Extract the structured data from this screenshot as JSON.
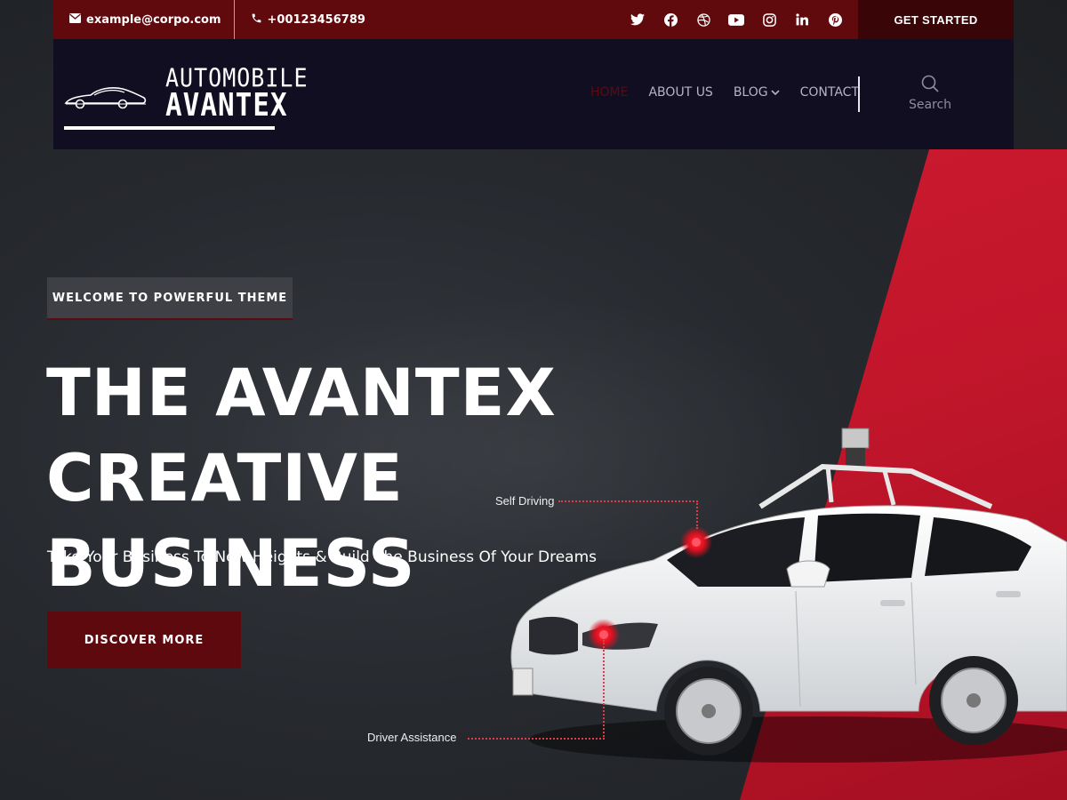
{
  "topbar": {
    "email": "example@corpo.com",
    "phone": "+00123456789",
    "social": [
      "twitter-icon",
      "facebook-icon",
      "dribbble-icon",
      "youtube-icon",
      "instagram-icon",
      "linkedin-icon",
      "pinterest-icon"
    ],
    "cta_label": "GET STARTED"
  },
  "logo": {
    "line1": "AUTOMOBILE",
    "line2": "AVANTEX"
  },
  "nav": {
    "items": [
      {
        "label": "HOME",
        "active": true
      },
      {
        "label": "ABOUT US"
      },
      {
        "label": "BLOG",
        "has_dropdown": true
      },
      {
        "label": "CONTACT"
      }
    ],
    "search_label": "Search"
  },
  "hero": {
    "badge": "WELCOME TO POWERFUL THEME",
    "title_line1": "THE AVANTEX CREATIVE",
    "title_line2": "BUSINESS",
    "subtitle": "Take Your Business To New Heights & Build The Business Of Your Dreams",
    "cta_label": "DISCOVER MORE"
  },
  "annotations": {
    "top": "Self Driving",
    "bottom": "Driver Assistance"
  },
  "colors": {
    "topbar_bg": "#600a0d",
    "nav_bg": "#110e22",
    "accent_red": "#d81f35",
    "button_dark_red": "#5e090d"
  }
}
